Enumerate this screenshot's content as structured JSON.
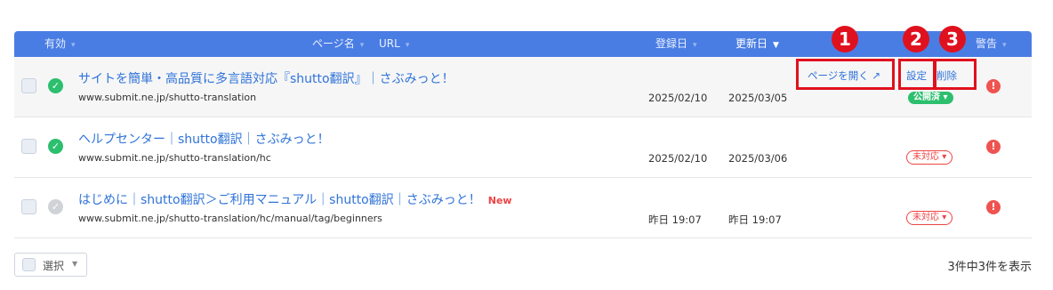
{
  "table": {
    "headers": {
      "valid": "有効",
      "page_name": "ページ名",
      "url": "URL",
      "registered": "登録日",
      "updated": "更新日",
      "warning": "警告"
    },
    "rows": [
      {
        "title": "サイトを簡単・高品質に多言語対応『shutto翻訳』｜さぶみっと！",
        "url": "www.submit.ne.jp/shutto-translation",
        "registered": "2025/02/10",
        "updated": "2025/03/05",
        "status": "公開済",
        "new": ""
      },
      {
        "title": "ヘルプセンター｜shutto翻訳｜さぶみっと！",
        "url": "www.submit.ne.jp/shutto-translation/hc",
        "registered": "2025/02/10",
        "updated": "2025/03/06",
        "status": "未対応",
        "new": ""
      },
      {
        "title": "はじめに｜shutto翻訳＞ご利用マニュアル｜shutto翻訳｜さぶみっと！",
        "url": "www.submit.ne.jp/shutto-translation/hc/manual/tag/beginners",
        "registered": "昨日 19:07",
        "updated": "昨日 19:07",
        "status": "未対応",
        "new": "New"
      }
    ],
    "actions": {
      "open_page": "ページを開く",
      "settings": "設定",
      "delete": "削除"
    }
  },
  "annotations": {
    "n1": "1",
    "n2": "2",
    "n3": "3"
  },
  "footer": {
    "select_label": "選択",
    "count_text": "3件中3件を表示"
  },
  "colors": {
    "header_bg": "#4a7de3",
    "link": "#2f73d9",
    "published": "#2cbf6e",
    "unpublished": "#ef4444",
    "annotation_red": "#e0111e"
  }
}
